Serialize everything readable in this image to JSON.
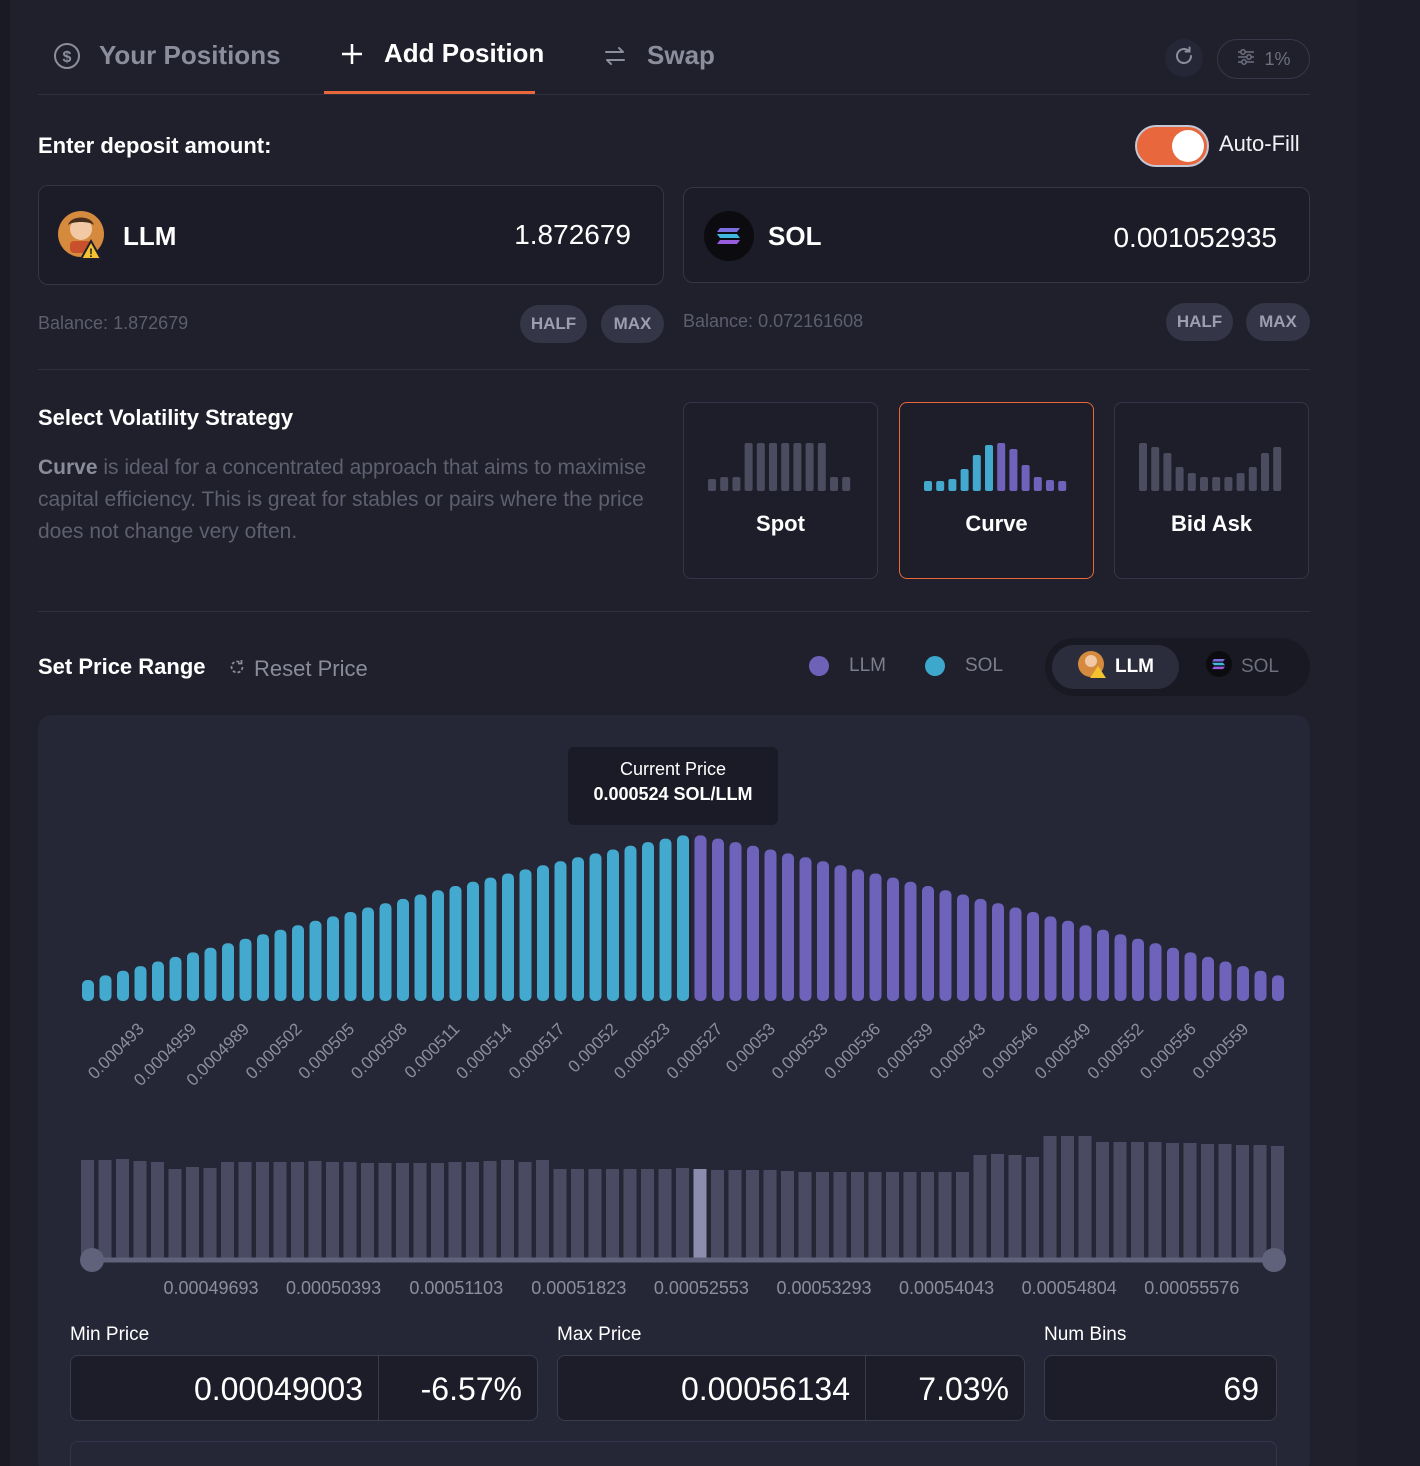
{
  "tabs": [
    {
      "label": "Your Positions",
      "icon": "dollar-circle-icon",
      "active": false
    },
    {
      "label": "Add Position",
      "icon": "plus-icon",
      "active": true
    },
    {
      "label": "Swap",
      "icon": "swap-arrows-icon",
      "active": false
    }
  ],
  "toolbar": {
    "refresh_icon": "refresh-icon",
    "slippage_label": "1%",
    "slippage_icon": "sliders-icon"
  },
  "deposit": {
    "label": "Enter deposit amount:",
    "autofill_label": "Auto-Fill",
    "autofill_on": true,
    "token_a": {
      "symbol": "LLM",
      "amount": "1.872679",
      "balance_label": "Balance:",
      "balance": "1.872679",
      "half": "HALF",
      "max": "MAX"
    },
    "token_b": {
      "symbol": "SOL",
      "amount": "0.001052935",
      "balance_label": "Balance:",
      "balance": "0.072161608",
      "half": "HALF",
      "max": "MAX"
    }
  },
  "strategy": {
    "title": "Select Volatility Strategy",
    "desc_bold": "Curve",
    "desc_rest": " is ideal for a concentrated approach that aims to maximise capital efficiency. This is great for stables or pairs where the price does not change very often.",
    "options": [
      {
        "label": "Spot",
        "selected": false
      },
      {
        "label": "Curve",
        "selected": true
      },
      {
        "label": "Bid Ask",
        "selected": false
      }
    ]
  },
  "price_range": {
    "title": "Set Price Range",
    "reset_label": "Reset Price",
    "legend": [
      {
        "label": "LLM",
        "color": "#6e62b8"
      },
      {
        "label": "SOL",
        "color": "#3ea8cc"
      }
    ],
    "toggle": [
      {
        "label": "LLM",
        "active": true
      },
      {
        "label": "SOL",
        "active": false
      }
    ]
  },
  "chart_data": {
    "type": "bar",
    "tooltip_title": "Current Price",
    "tooltip_value": "0.000524 SOL/LLM",
    "current_price": 0.000524,
    "colors": {
      "sol": "#43a9ce",
      "llm": "#6f62bb"
    },
    "tick_labels": [
      "0.000493",
      "0.0004959",
      "0.0004989",
      "0.000502",
      "0.000505",
      "0.000508",
      "0.000511",
      "0.000514",
      "0.000517",
      "0.00052",
      "0.000523",
      "0.000527",
      "0.00053",
      "0.000533",
      "0.000536",
      "0.000539",
      "0.000543",
      "0.000546",
      "0.000549",
      "0.000552",
      "0.000556",
      "0.000559"
    ],
    "sol_bins": 35,
    "llm_bins": 34,
    "liquidity_axis": [
      "0.00049693",
      "0.00050393",
      "0.00051103",
      "0.00051823",
      "0.00052553",
      "0.00053293",
      "0.00054043",
      "0.00054804",
      "0.00055576"
    ]
  },
  "range": {
    "min_label": "Min Price",
    "min_value": "0.00049003",
    "min_pct": "-6.57%",
    "max_label": "Max Price",
    "max_value": "0.00056134",
    "max_pct": "7.03%",
    "bins_label": "Num Bins",
    "bins_value": "69"
  }
}
